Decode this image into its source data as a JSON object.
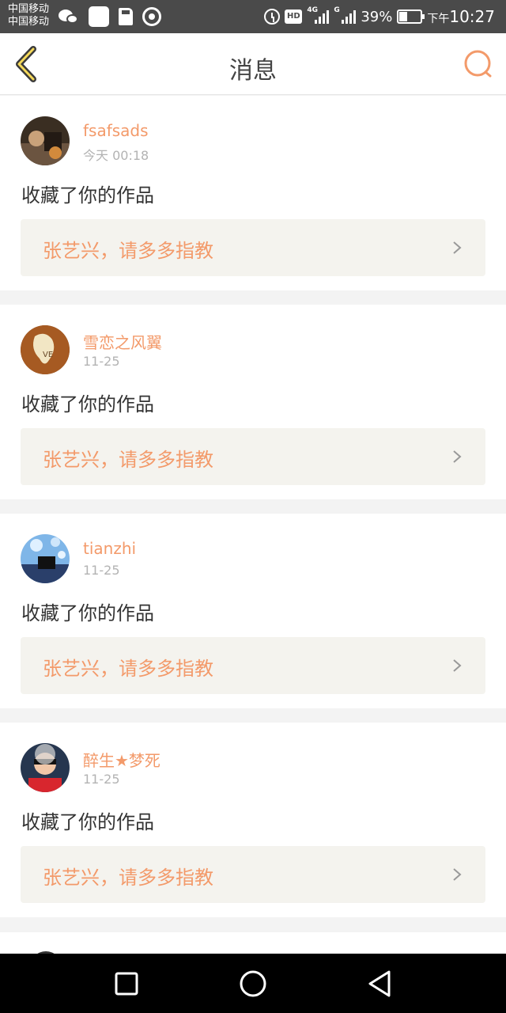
{
  "status_bar": {
    "carrier_1": "中国移动",
    "carrier_2": "中国移动",
    "network_1": "4G",
    "network_2": "G",
    "battery_percent": "39%",
    "battery_level": 0.39,
    "time_prefix": "下午",
    "time": "10:27",
    "icons": [
      "wechat-icon",
      "notification-icon",
      "sd-card-icon",
      "nfc-icon",
      "alarm-icon",
      "hd-icon",
      "signal-icon",
      "signal-icon",
      "battery-icon"
    ]
  },
  "header": {
    "title": "消息",
    "back_icon": "chevron-left-icon",
    "search_icon": "search-icon",
    "accent_color": "#f39a6a"
  },
  "messages": [
    {
      "username": "fsafsads",
      "time": "今天 00:18",
      "action": "收藏了你的作品",
      "work_title": "张艺兴，请多多指教"
    },
    {
      "username": "雪恋之风翼",
      "time": "11-25",
      "action": "收藏了你的作品",
      "work_title": "张艺兴，请多多指教"
    },
    {
      "username": "tianzhi",
      "time": "11-25",
      "action": "收藏了你的作品",
      "work_title": "张艺兴，请多多指教"
    },
    {
      "username": "醉生★梦死",
      "time": "11-25",
      "action": "收藏了你的作品",
      "work_title": "张艺兴，请多多指教"
    }
  ],
  "nav_bar": {
    "buttons": [
      "recents-icon",
      "home-icon",
      "back-icon"
    ]
  }
}
